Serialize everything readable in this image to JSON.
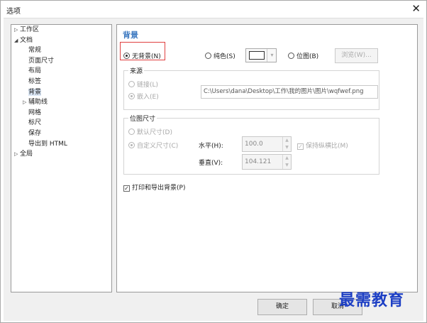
{
  "window": {
    "title": "选项",
    "close_glyph": "✕"
  },
  "tree": {
    "items": [
      {
        "label": "工作区",
        "twisty": "▷",
        "level": 0,
        "selected": false
      },
      {
        "label": "文档",
        "twisty": "◢",
        "level": 0,
        "selected": false
      },
      {
        "label": "常规",
        "twisty": "",
        "level": 1,
        "selected": false
      },
      {
        "label": "页面尺寸",
        "twisty": "",
        "level": 1,
        "selected": false
      },
      {
        "label": "布局",
        "twisty": "",
        "level": 1,
        "selected": false
      },
      {
        "label": "标签",
        "twisty": "",
        "level": 1,
        "selected": false
      },
      {
        "label": "背景",
        "twisty": "",
        "level": 1,
        "selected": true
      },
      {
        "label": "辅助线",
        "twisty": "▷",
        "level": 1,
        "selected": false
      },
      {
        "label": "网格",
        "twisty": "",
        "level": 1,
        "selected": false
      },
      {
        "label": "标尺",
        "twisty": "",
        "level": 1,
        "selected": false
      },
      {
        "label": "保存",
        "twisty": "",
        "level": 1,
        "selected": false
      },
      {
        "label": "导出到 HTML",
        "twisty": "",
        "level": 1,
        "selected": false
      },
      {
        "label": "全局",
        "twisty": "▷",
        "level": 0,
        "selected": false
      }
    ]
  },
  "panel": {
    "title": "背景",
    "no_background": "无背景(N)",
    "solid": "纯色(S)",
    "bitmap": "位图(B)",
    "browse": "浏览(W)...",
    "source": {
      "label": "来源",
      "link": "链接(L)",
      "embed": "嵌入(E)",
      "path": "C:\\Users\\dana\\Desktop\\工作\\我的图片\\图片\\wqfwef.png"
    },
    "bitmap_size": {
      "label": "位图尺寸",
      "default_size": "默认尺寸(D)",
      "custom_size": "自定义尺寸(C)",
      "horizontal_label": "水平(H):",
      "horizontal_value": "100.0",
      "vertical_label": "垂直(V):",
      "vertical_value": "104.121",
      "keep_ratio": "保持纵横比(M)"
    },
    "print_export": "打印和导出背景(P)",
    "check_glyph": "✓"
  },
  "buttons": {
    "ok": "确定",
    "cancel": "取消"
  },
  "watermark": "最需教育",
  "colors": {
    "accent": "#3b78c0",
    "highlight_border": "#e04040",
    "watermark": "#1d3fc4"
  }
}
